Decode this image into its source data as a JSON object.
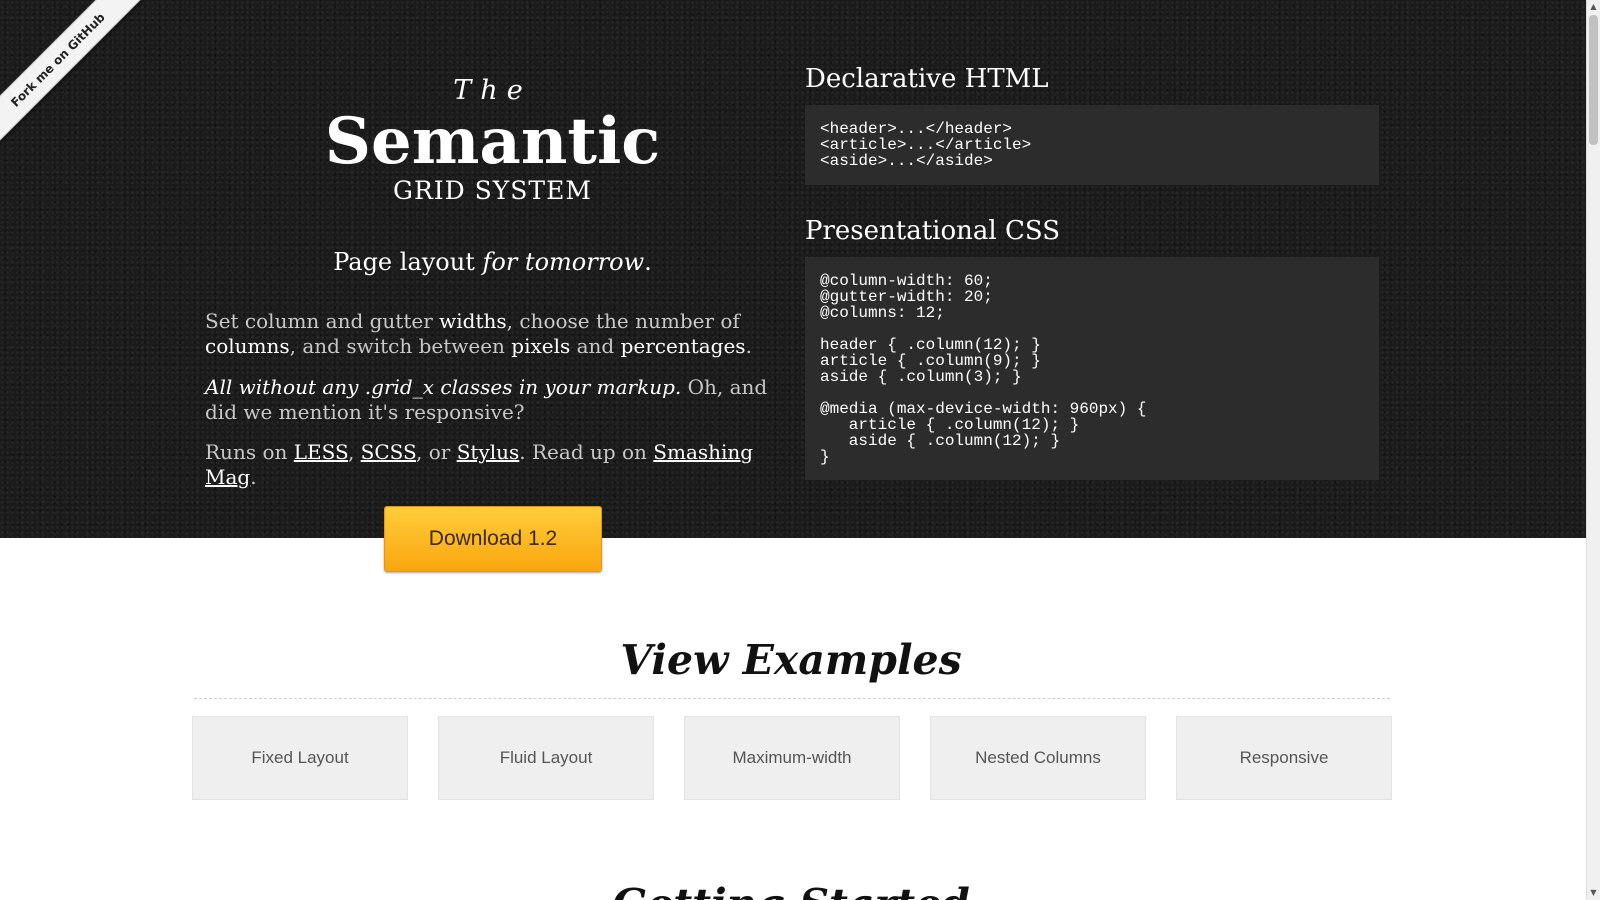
{
  "ribbon": {
    "label": "Fork me on GitHub"
  },
  "brand": {
    "the": "The",
    "main": "Semantic",
    "sub": "GRID SYSTEM"
  },
  "tagline": {
    "prefix": "Page layout ",
    "emphasis": "for tomorrow",
    "suffix": "."
  },
  "intro": {
    "p1": {
      "t1": "Set column and gutter ",
      "w1": "widths",
      "t2": ", choose the number of ",
      "w2": "columns",
      "t3": ", and switch between ",
      "w3": "pixels",
      "t4": " and ",
      "w4": "percentages",
      "t5": "."
    },
    "p2": {
      "italic": "All without any .grid_x classes in your markup.",
      "rest": " Oh, and did we mention it's responsive?"
    },
    "p3": {
      "t1": "Runs on ",
      "link1": "LESS",
      "t2": ", ",
      "link2": "SCSS",
      "t3": ", or ",
      "link3": "Stylus",
      "t4": ". Read up on ",
      "link4": "Smashing Mag",
      "t5": "."
    }
  },
  "download": {
    "label": "Download 1.2"
  },
  "html_block": {
    "title": "Declarative HTML",
    "code": "<header>...</header>\n<article>...</article>\n<aside>...</aside>"
  },
  "css_block": {
    "title": "Presentational CSS",
    "code": "@column-width: 60;\n@gutter-width: 20;\n@columns: 12;\n\nheader { .column(12); }\narticle { .column(9); }\naside { .column(3); }\n\n@media (max-device-width: 960px) {\n   article { .column(12); }\n   aside { .column(12); }\n}"
  },
  "examples": {
    "title": "View Examples",
    "items": [
      {
        "label": "Fixed Layout"
      },
      {
        "label": "Fluid Layout"
      },
      {
        "label": "Maximum-width"
      },
      {
        "label": "Nested Columns"
      },
      {
        "label": "Responsive"
      }
    ]
  },
  "next_section": {
    "title": "Getting Started"
  },
  "scrollbar": {
    "up_icon": "arrow-up",
    "down_icon": "arrow-down"
  },
  "colors": {
    "hero_bg": "#1b1b1b",
    "button_top": "#ffcd3a",
    "button_bottom": "#f9a60f",
    "code_bg": "#2c2c2c",
    "example_bg": "#efefef"
  }
}
